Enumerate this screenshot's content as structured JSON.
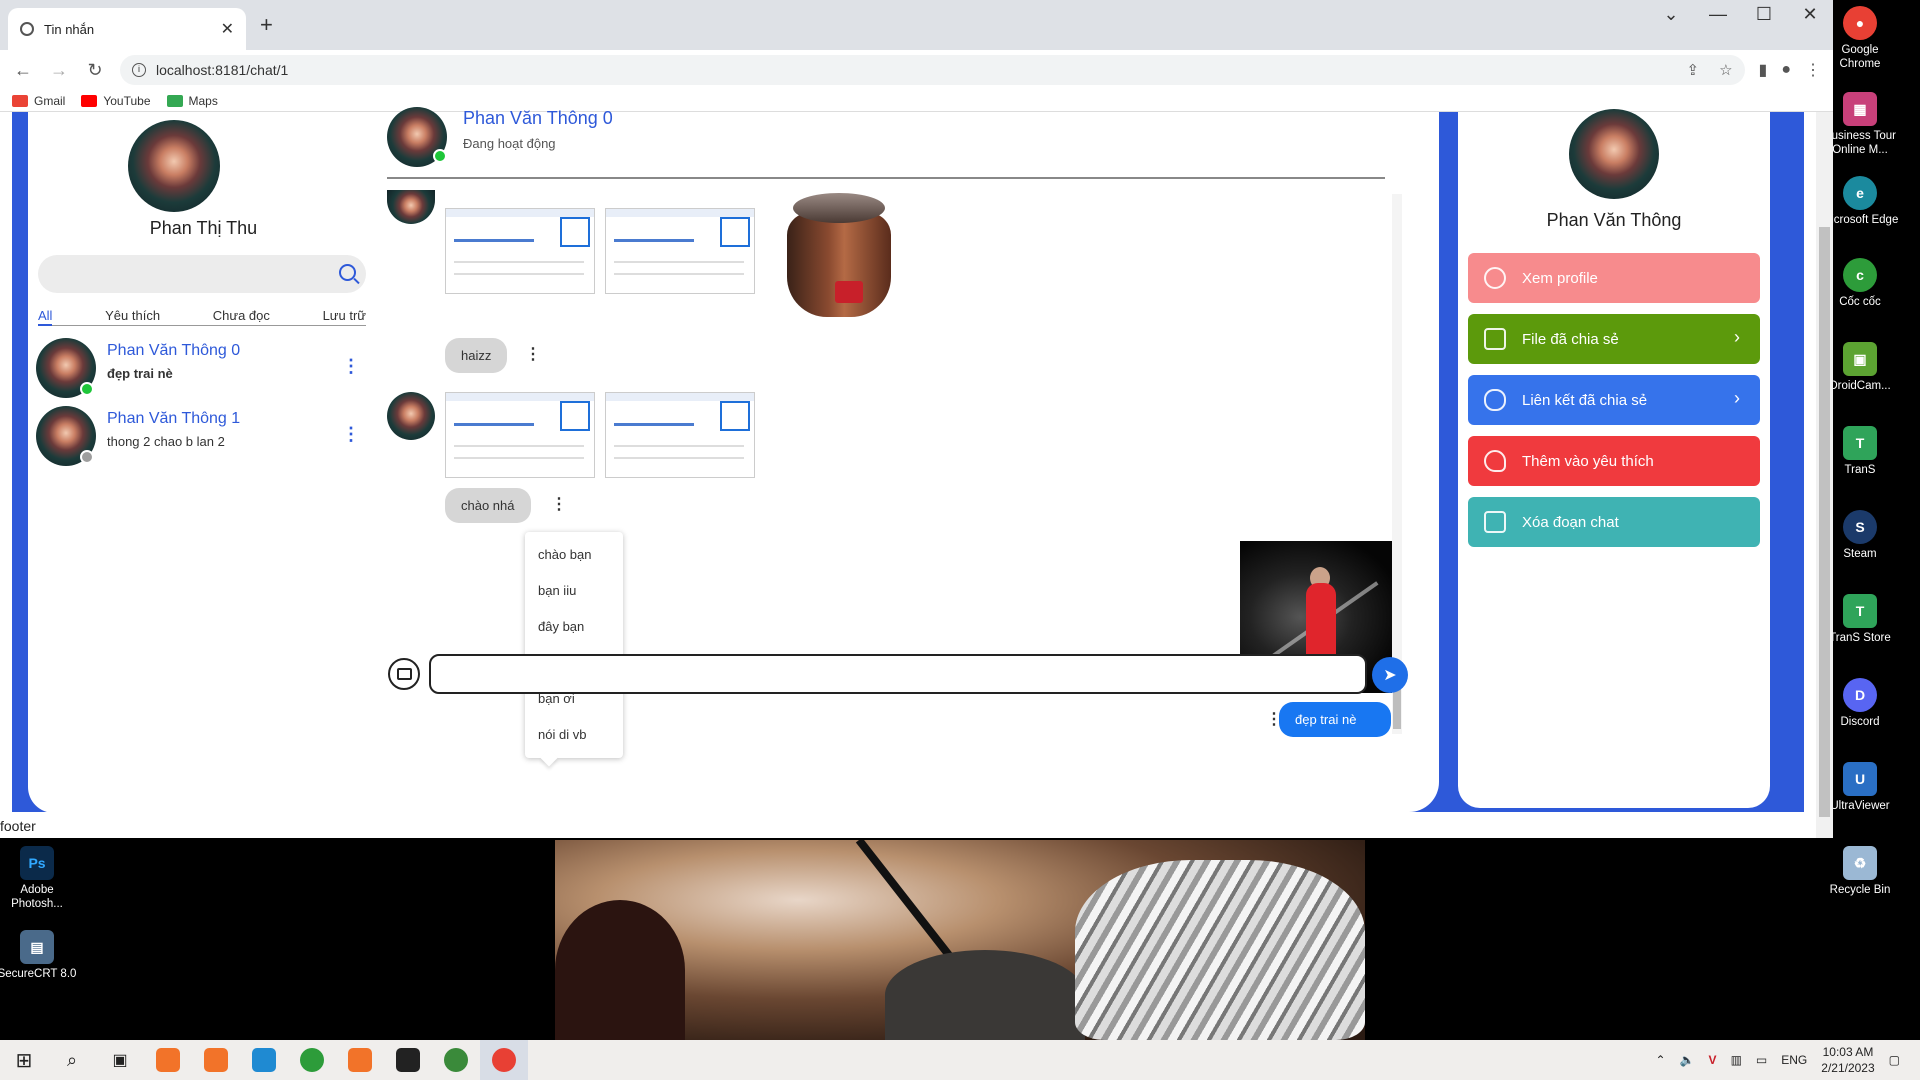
{
  "browser": {
    "tab_title": "Tin nhắn",
    "url": "localhost:8181/chat/1",
    "bookmarks": [
      "Gmail",
      "YouTube",
      "Maps"
    ]
  },
  "me": {
    "name": "Phan Thị Thu"
  },
  "search": {
    "placeholder": ""
  },
  "filters": [
    "All",
    "Yêu thích",
    "Chưa đọc",
    "Lưu trữ"
  ],
  "conversations": [
    {
      "name": "Phan Văn Thông 0",
      "last_message": "đẹp trai nè",
      "status_color": "#1ec639"
    },
    {
      "name": "Phan Văn Thông 1",
      "last_message": "thong 2 chao b lan 2",
      "status_color": "#9e9e9e"
    }
  ],
  "chat": {
    "peer_name": "Phan Văn Thông 0",
    "peer_status": "Đang hoạt động",
    "messages": {
      "haizz": "haizz",
      "chao_nha": "chào nhá",
      "sent": "đẹp trai nè"
    },
    "quick_replies": [
      "chào bạn",
      "bạn iiu",
      "đây bạn",
      "bạn ơi",
      "bạn ơi",
      "nói di vb"
    ],
    "input_value": ""
  },
  "profile_panel": {
    "name": "Phan Văn Thông",
    "actions": [
      {
        "label": "Xem profile",
        "color": "#f78b8d",
        "icon": "user-icon",
        "chevron": false
      },
      {
        "label": "File đã chia sẻ",
        "color": "#5c9a0c",
        "icon": "file-icon",
        "chevron": true
      },
      {
        "label": "Liên kết đã chia sẻ",
        "color": "#3673eb",
        "icon": "link-icon",
        "chevron": true
      },
      {
        "label": "Thêm vào yêu thích",
        "color": "#f03a3e",
        "icon": "heart-icon",
        "chevron": false
      },
      {
        "label": "Xóa đoạn chat",
        "color": "#3fb3b3",
        "icon": "trash-icon",
        "chevron": false
      }
    ]
  },
  "footer": {
    "text": "footer"
  },
  "desktop_icons": [
    {
      "label": "Google Chrome",
      "color": "#e84034"
    },
    {
      "label": "Business Tour Online M...",
      "color": "#c8407a"
    },
    {
      "label": "Microsoft Edge",
      "color": "#1b8a9e"
    },
    {
      "label": "Cốc cốc",
      "color": "#2d9c3a"
    },
    {
      "label": "DroidCam...",
      "color": "#5ca332"
    },
    {
      "label": "TranS",
      "color": "#2fa45a"
    },
    {
      "label": "Steam",
      "color": "#1b3a6a"
    },
    {
      "label": "TranS Store",
      "color": "#2fa45a"
    },
    {
      "label": "Discord",
      "color": "#5865f2"
    },
    {
      "label": "UltraViewer",
      "color": "#2a6fc4"
    },
    {
      "label": "Recycle Bin",
      "color": "#9bb8d4"
    },
    {
      "label": "Adobe Photosh...",
      "color": "#0b2a4a"
    },
    {
      "label": "SecureCRT 8.0",
      "color": "#4a6a8a"
    }
  ],
  "taskbar": {
    "language": "ENG",
    "time": "10:03 AM",
    "date": "2/21/2023"
  }
}
